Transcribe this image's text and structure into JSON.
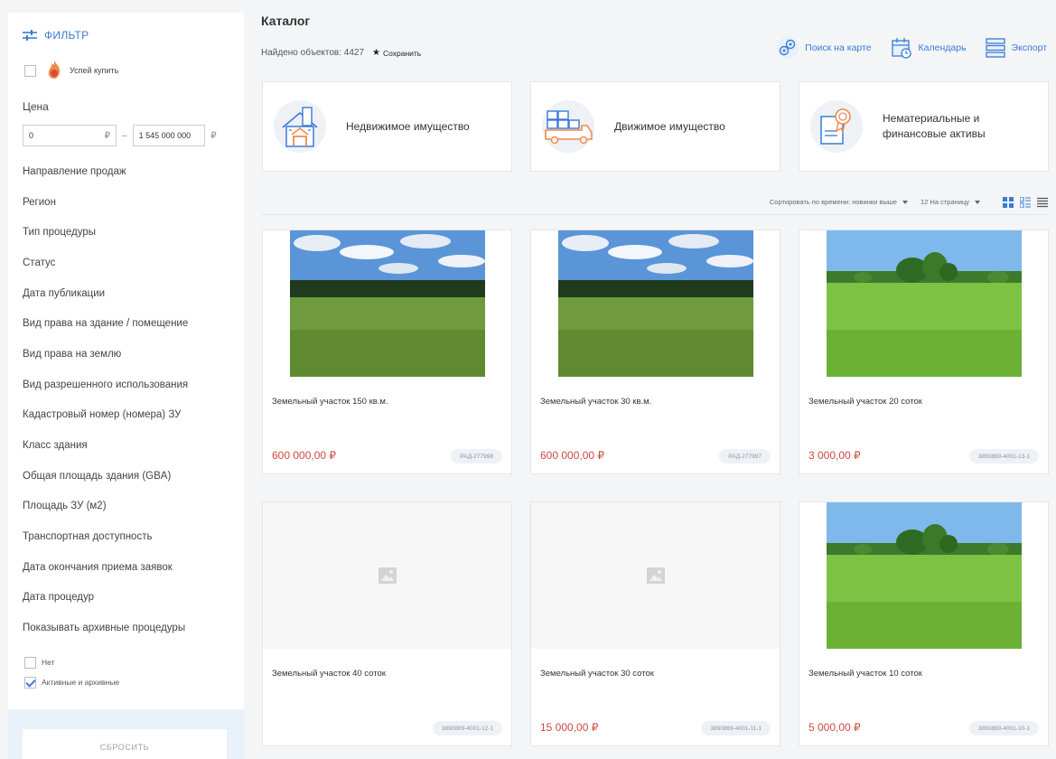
{
  "sidebar": {
    "filter_title": "ФИЛЬТР",
    "hurry_label": "Успей купить",
    "price_label": "Цена",
    "price_from": "0",
    "price_to": "1 545 000 000",
    "currency": "₽",
    "price_dash": "–",
    "items": [
      "Направление продаж",
      "Регион",
      "Тип процедуры",
      "Статус",
      "Дата публикации",
      "Вид права на здание / помещение",
      "Вид права на землю",
      "Вид разрешенного использования",
      "Кадастровый номер (номера) ЗУ",
      "Класс здания",
      "Общая площадь здания (GBA)",
      "Площадь ЗУ (м2)",
      "Транспортная доступность",
      "Дата окончания приема заявок",
      "Дата процедур",
      "Показывать архивные процедуры"
    ],
    "archive_options": [
      {
        "label": "Нет",
        "checked": false
      },
      {
        "label": "Активные и архивные",
        "checked": true
      }
    ],
    "reset_label": "СБРОСИТЬ"
  },
  "main": {
    "title": "Каталог",
    "found_text": "Найдено объектов: 4427",
    "save_label": "Сохранить",
    "tools": {
      "map_search": "Поиск на карте",
      "calendar": "Календарь",
      "export": "Экспорт"
    },
    "categories": [
      {
        "label": "Недвижимое имущество",
        "icon": "building-icon"
      },
      {
        "label": "Движимое имущество",
        "icon": "truck-icon"
      },
      {
        "label": "Нематериальные и финансовые активы",
        "icon": "certificate-icon"
      }
    ],
    "sort_label": "Сортировать по времени: новинки выше",
    "per_page_label": "12 На страницу",
    "cards": [
      {
        "title": "Земельный участок 150 кв.м.",
        "price": "600 000,00 ₽",
        "code": "РАД-277998",
        "image": "field-forest"
      },
      {
        "title": "Земельный участок 30 кв.м.",
        "price": "600 000,00 ₽",
        "code": "РАД-277997",
        "image": "field-forest"
      },
      {
        "title": "Земельный участок 20 соток",
        "price": "3 000,00 ₽",
        "code": "3890869-4001-13-1",
        "image": "meadow-trees"
      },
      {
        "title": "Земельный участок 40 соток",
        "price": "",
        "code": "3890869-4001-12-1",
        "image": "none"
      },
      {
        "title": "Земельный участок 30 соток",
        "price": "15 000,00 ₽",
        "code": "3890869-4001-11-1",
        "image": "none"
      },
      {
        "title": "Земельный участок 10 соток",
        "price": "5 000,00 ₽",
        "code": "3890869-4001-10-1",
        "image": "meadow-trees"
      }
    ]
  },
  "colors": {
    "accent": "#3a7bd5",
    "price": "#d04a3d",
    "orange_icon": "#f08a4b"
  }
}
